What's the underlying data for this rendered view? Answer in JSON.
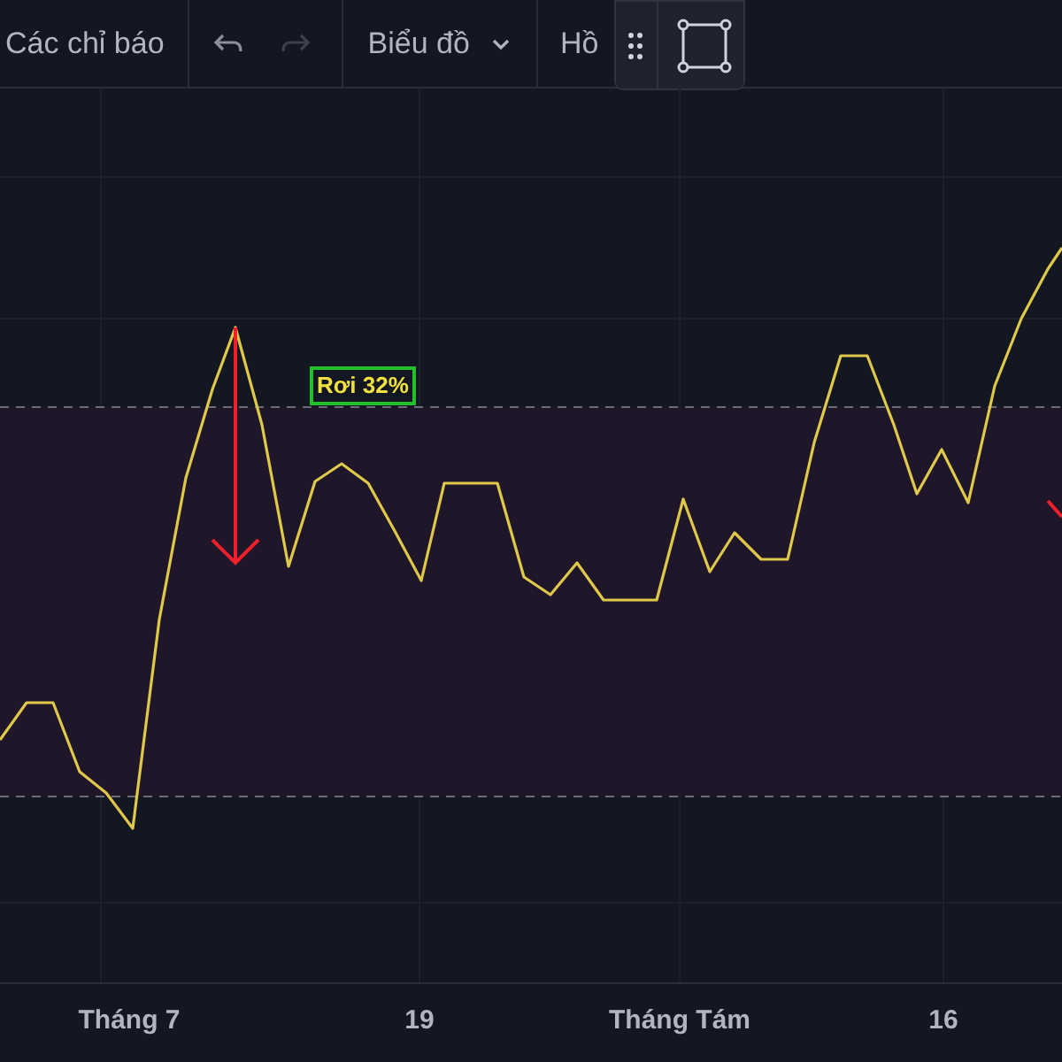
{
  "toolbar": {
    "indicators_button": {
      "label": "Các chỉ báo"
    },
    "undo": {
      "disabled": false
    },
    "redo": {
      "disabled": true
    },
    "chart_type_button": {
      "label": "Biểu đồ"
    },
    "cut_item": {
      "label": "Hồ"
    }
  },
  "chart": {
    "annotation": {
      "label": "Rơi 32%"
    }
  },
  "x_axis": {
    "labels": [
      "Tháng 7",
      "19",
      "Tháng Tám",
      "16"
    ]
  }
}
